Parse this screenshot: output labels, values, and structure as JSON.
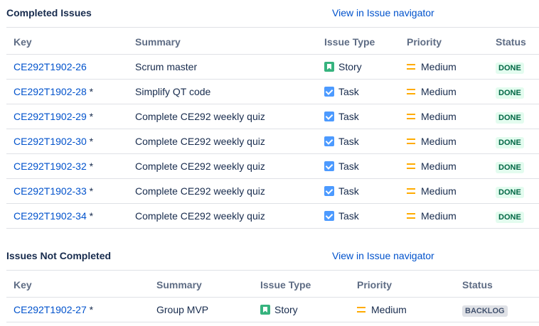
{
  "completed": {
    "title": "Completed Issues",
    "nav_link": "View in Issue navigator",
    "headers": {
      "key": "Key",
      "summary": "Summary",
      "type": "Issue Type",
      "priority": "Priority",
      "status": "Status"
    },
    "rows": [
      {
        "key": "CE292T1902-26",
        "star": "",
        "summary": "Scrum master",
        "type": "Story",
        "type_icon": "story-icon",
        "priority": "Medium",
        "status": "DONE"
      },
      {
        "key": "CE292T1902-28",
        "star": " *",
        "summary": "Simplify QT code",
        "type": "Task",
        "type_icon": "task-icon",
        "priority": "Medium",
        "status": "DONE"
      },
      {
        "key": "CE292T1902-29",
        "star": " *",
        "summary": "Complete CE292 weekly quiz",
        "type": "Task",
        "type_icon": "task-icon",
        "priority": "Medium",
        "status": "DONE"
      },
      {
        "key": "CE292T1902-30",
        "star": " *",
        "summary": "Complete CE292 weekly quiz",
        "type": "Task",
        "type_icon": "task-icon",
        "priority": "Medium",
        "status": "DONE"
      },
      {
        "key": "CE292T1902-32",
        "star": " *",
        "summary": "Complete CE292 weekly quiz",
        "type": "Task",
        "type_icon": "task-icon",
        "priority": "Medium",
        "status": "DONE"
      },
      {
        "key": "CE292T1902-33",
        "star": " *",
        "summary": "Complete CE292 weekly quiz",
        "type": "Task",
        "type_icon": "task-icon",
        "priority": "Medium",
        "status": "DONE"
      },
      {
        "key": "CE292T1902-34",
        "star": " *",
        "summary": "Complete CE292 weekly quiz",
        "type": "Task",
        "type_icon": "task-icon",
        "priority": "Medium",
        "status": "DONE"
      }
    ]
  },
  "not_completed": {
    "title": "Issues Not Completed",
    "nav_link": "View in Issue navigator",
    "headers": {
      "key": "Key",
      "summary": "Summary",
      "type": "Issue Type",
      "priority": "Priority",
      "status": "Status"
    },
    "rows": [
      {
        "key": "CE292T1902-27",
        "star": " *",
        "summary": "Group MVP",
        "type": "Story",
        "type_icon": "story-icon",
        "priority": "Medium",
        "status": "BACKLOG"
      }
    ]
  },
  "colors": {
    "link": "#0052cc",
    "story": "#36b37e",
    "task": "#4c9aff",
    "medium": "#ffab00",
    "done_bg": "#e3fcef",
    "done_fg": "#006644",
    "backlog_bg": "#dfe1e6"
  }
}
